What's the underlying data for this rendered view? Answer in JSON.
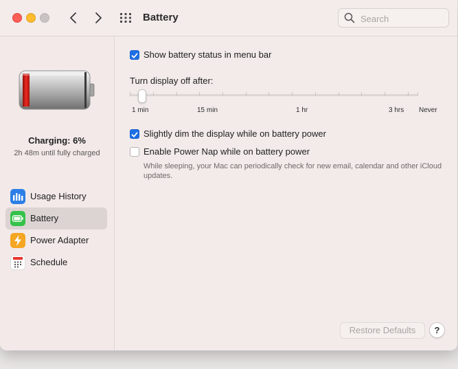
{
  "window": {
    "title": "Battery"
  },
  "search": {
    "placeholder": "Search"
  },
  "sidebar": {
    "charging_status": "Charging: 6%",
    "charging_detail": "2h 48m until fully charged",
    "items": [
      {
        "label": "Usage History",
        "icon": "bar-chart-icon",
        "selected": false
      },
      {
        "label": "Battery",
        "icon": "battery-icon",
        "selected": true
      },
      {
        "label": "Power Adapter",
        "icon": "lightning-icon",
        "selected": false
      },
      {
        "label": "Schedule",
        "icon": "calendar-icon",
        "selected": false
      }
    ]
  },
  "battery_level_percent": 6,
  "settings": {
    "show_status": {
      "label": "Show battery status in menu bar",
      "checked": true
    },
    "display_off_label": "Turn display off after:",
    "slider": {
      "labels": [
        "1 min",
        "15 min",
        "1 hr",
        "3 hrs",
        "Never"
      ],
      "value": "1 min"
    },
    "dim_display": {
      "label": "Slightly dim the display while on battery power",
      "checked": true
    },
    "power_nap": {
      "label": "Enable Power Nap while on battery power",
      "checked": false,
      "note": "While sleeping, your Mac can periodically check for new email, calendar and other iCloud updates."
    }
  },
  "footer": {
    "restore_label": "Restore Defaults",
    "help_label": "?"
  },
  "colors": {
    "accent": "#1f6fe5",
    "low_battery": "#d9231f",
    "window_bg": "#f2ebea"
  }
}
